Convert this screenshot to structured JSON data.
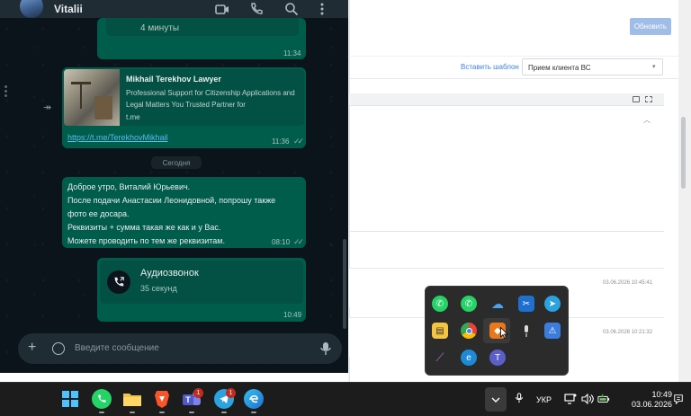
{
  "whatsapp": {
    "contact_name": "Vitalii",
    "prev_message": {
      "text": "4 минуты",
      "time": "11:34"
    },
    "link_message": {
      "title": "Mikhail Terekhov Lawyer",
      "description": "Professional Support for Citizenship Applications and Legal Matters You Trusted Partner for",
      "domain": "t.me",
      "url": "https://t.me/TerekhovMikhail",
      "time": "11:36"
    },
    "date_separator": "Сегодня",
    "text_message": {
      "lines": [
        "Доброе утро, Виталий Юрьевич.",
        "После подачи Анастасии Леонидовной, попрошу также",
        "фото ее досара.",
        "Реквизиты + сумма такая же как и у Вас.",
        "Можете проводить по тем же реквизитам."
      ],
      "time": "08:10"
    },
    "call_message": {
      "title": "Аудиозвонок",
      "duration": "35 секунд",
      "time": "10:49"
    },
    "input_placeholder": "Введите сообщение"
  },
  "background_app": {
    "primary_button": "Обновить",
    "insert_template_link": "Вставить шаблон",
    "template_select_value": "Прием клиента ВС",
    "row_dates": [
      "03.06.2026 10:45:41",
      "03.06.2026 10:21:32"
    ]
  },
  "tray_popup": {
    "icons": [
      "whatsapp-icon",
      "whatsapp-icon",
      "onedrive-icon",
      "snipping-tool-icon",
      "telegram-icon",
      "sticky-notes-icon",
      "chrome-icon",
      "office-icon",
      "microphone-icon",
      "security-warning-icon",
      "feather-icon",
      "edge-icon",
      "teams-icon"
    ]
  },
  "taskbar": {
    "apps": [
      "windows-start-icon",
      "whatsapp-icon",
      "file-explorer-icon",
      "brave-icon",
      "teams-icon",
      "telegram-icon",
      "edge-icon"
    ],
    "teams_badge": "1",
    "telegram_badge": "1",
    "language": "УКР",
    "time": "10:49",
    "date": "03.06.2026"
  },
  "colors": {
    "wa_background": "#0b141a",
    "wa_outgoing_bubble": "#005c4b",
    "wa_header": "#202c33",
    "link_blue": "#53bdeb",
    "taskbar": "#1c1c1c",
    "accent_button": "#9fbde6"
  }
}
